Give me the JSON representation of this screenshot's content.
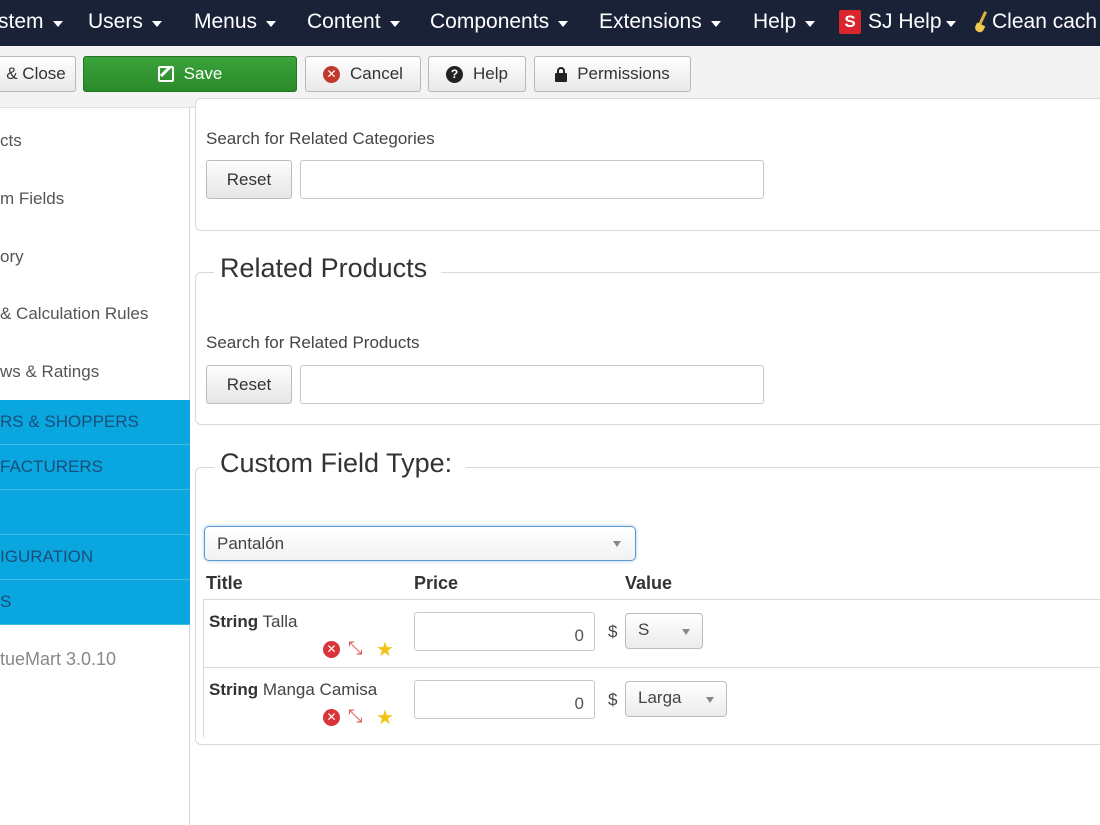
{
  "topnav": {
    "items": [
      {
        "label": "stem"
      },
      {
        "label": "Users"
      },
      {
        "label": "Menus"
      },
      {
        "label": "Content"
      },
      {
        "label": "Components"
      },
      {
        "label": "Extensions"
      },
      {
        "label": "Help"
      }
    ],
    "sj_logo": "S",
    "sj_help": "SJ Help",
    "clean_cache": "Clean cach"
  },
  "toolbar": {
    "save_close": "& Close",
    "save": "Save",
    "cancel": "Cancel",
    "help": "Help",
    "permissions": "Permissions"
  },
  "sidebar": {
    "links": [
      "cts",
      "m Fields",
      "ory",
      "& Calculation Rules",
      "ws & Ratings"
    ],
    "sections": [
      "RS & SHOPPERS",
      "FACTURERS",
      "",
      "IGURATION",
      "S"
    ],
    "version": "tueMart 3.0.10"
  },
  "main": {
    "related_categories": {
      "label": "Search for Related Categories",
      "reset": "Reset",
      "search_value": ""
    },
    "related_products": {
      "legend": "Related Products",
      "label": "Search for Related Products",
      "reset": "Reset",
      "search_value": ""
    },
    "custom_field": {
      "legend": "Custom Field Type:",
      "selected": "Pantalón",
      "headers": {
        "title": "Title",
        "price": "Price",
        "value": "Value"
      },
      "rows": [
        {
          "type": "String",
          "name": "Talla",
          "price": "0",
          "currency": "$",
          "value": "S"
        },
        {
          "type": "String",
          "name": "Manga Camisa",
          "price": "0",
          "currency": "$",
          "value": "Larga"
        }
      ]
    }
  }
}
